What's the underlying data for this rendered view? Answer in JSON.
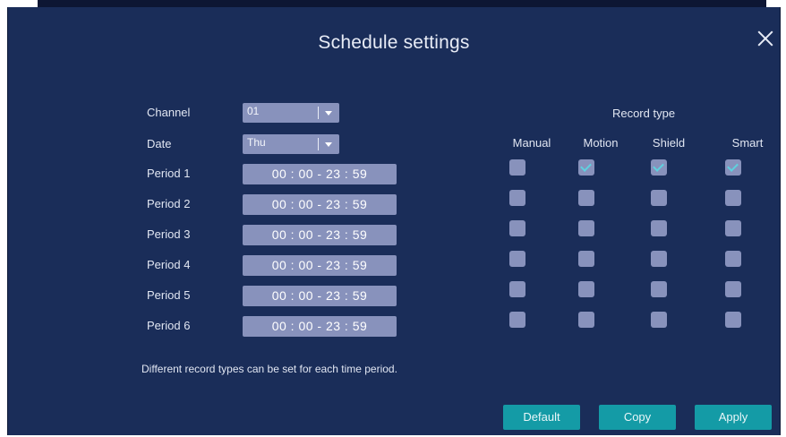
{
  "dialog": {
    "title": "Schedule settings",
    "close_icon": "close-icon"
  },
  "form": {
    "channel": {
      "label": "Channel",
      "value": "01"
    },
    "date": {
      "label": "Date",
      "value": "Thu"
    }
  },
  "periods": [
    {
      "label": "Period 1",
      "time": "00 : 00 - 23 : 59"
    },
    {
      "label": "Period 2",
      "time": "00 : 00 - 23 : 59"
    },
    {
      "label": "Period 3",
      "time": "00 : 00 - 23 : 59"
    },
    {
      "label": "Period 4",
      "time": "00 : 00 - 23 : 59"
    },
    {
      "label": "Period 5",
      "time": "00 : 00 - 23 : 59"
    },
    {
      "label": "Period 6",
      "time": "00 : 00 - 23 : 59"
    }
  ],
  "record_type": {
    "title": "Record type",
    "columns": [
      "Manual",
      "Motion",
      "Shield",
      "Smart"
    ],
    "checked": [
      [
        false,
        true,
        true,
        true
      ],
      [
        false,
        false,
        false,
        false
      ],
      [
        false,
        false,
        false,
        false
      ],
      [
        false,
        false,
        false,
        false
      ],
      [
        false,
        false,
        false,
        false
      ],
      [
        false,
        false,
        false,
        false
      ]
    ]
  },
  "note": "Different record types can be set for each time period.",
  "buttons": {
    "default": "Default",
    "copy": "Copy",
    "apply": "Apply"
  },
  "colors": {
    "background": "#1a2d59",
    "field": "#8892bc",
    "accent_button": "#149ba6",
    "check": "#5fd0de"
  }
}
